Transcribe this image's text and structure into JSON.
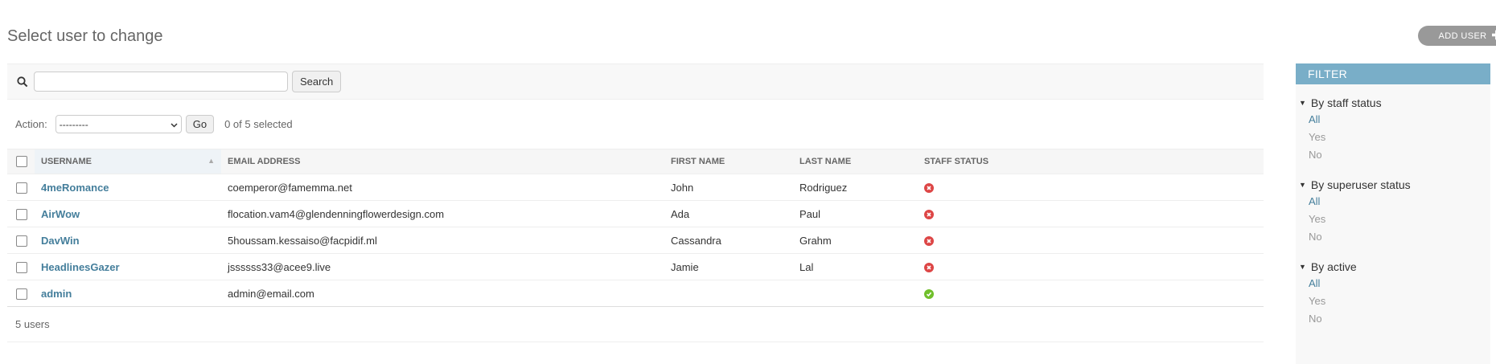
{
  "page": {
    "title": "Select user to change",
    "add_user_label": "ADD USER"
  },
  "search": {
    "value": "",
    "placeholder": "",
    "button_label": "Search"
  },
  "actions": {
    "label": "Action:",
    "selected_option": "---------",
    "go_label": "Go",
    "selected_count": "0 of 5 selected"
  },
  "table": {
    "headers": [
      "USERNAME",
      "EMAIL ADDRESS",
      "FIRST NAME",
      "LAST NAME",
      "STAFF STATUS"
    ],
    "rows": [
      {
        "username": "4meRomance",
        "email": "coemperor@famemma.net",
        "first_name": "John",
        "last_name": "Rodriguez",
        "staff": false
      },
      {
        "username": "AirWow",
        "email": "flocation.vam4@glendenningflowerdesign.com",
        "first_name": "Ada",
        "last_name": "Paul",
        "staff": false
      },
      {
        "username": "DavWin",
        "email": "5houssam.kessaiso@facpidif.ml",
        "first_name": "Cassandra",
        "last_name": "Grahm",
        "staff": false
      },
      {
        "username": "HeadlinesGazer",
        "email": "jssssss33@acee9.live",
        "first_name": "Jamie",
        "last_name": "Lal",
        "staff": false
      },
      {
        "username": "admin",
        "email": "admin@email.com",
        "first_name": "",
        "last_name": "",
        "staff": true
      }
    ]
  },
  "paginator": {
    "text": "5 users"
  },
  "filter": {
    "title": "FILTER",
    "groups": [
      {
        "title": "By staff status",
        "options": [
          "All",
          "Yes",
          "No"
        ]
      },
      {
        "title": "By superuser status",
        "options": [
          "All",
          "Yes",
          "No"
        ]
      },
      {
        "title": "By active",
        "options": [
          "All",
          "Yes",
          "No"
        ]
      }
    ]
  },
  "colors": {
    "link": "#447e9b",
    "filter_header": "#79aec8",
    "status_no": "#dd4646",
    "status_yes": "#70bf2b"
  }
}
